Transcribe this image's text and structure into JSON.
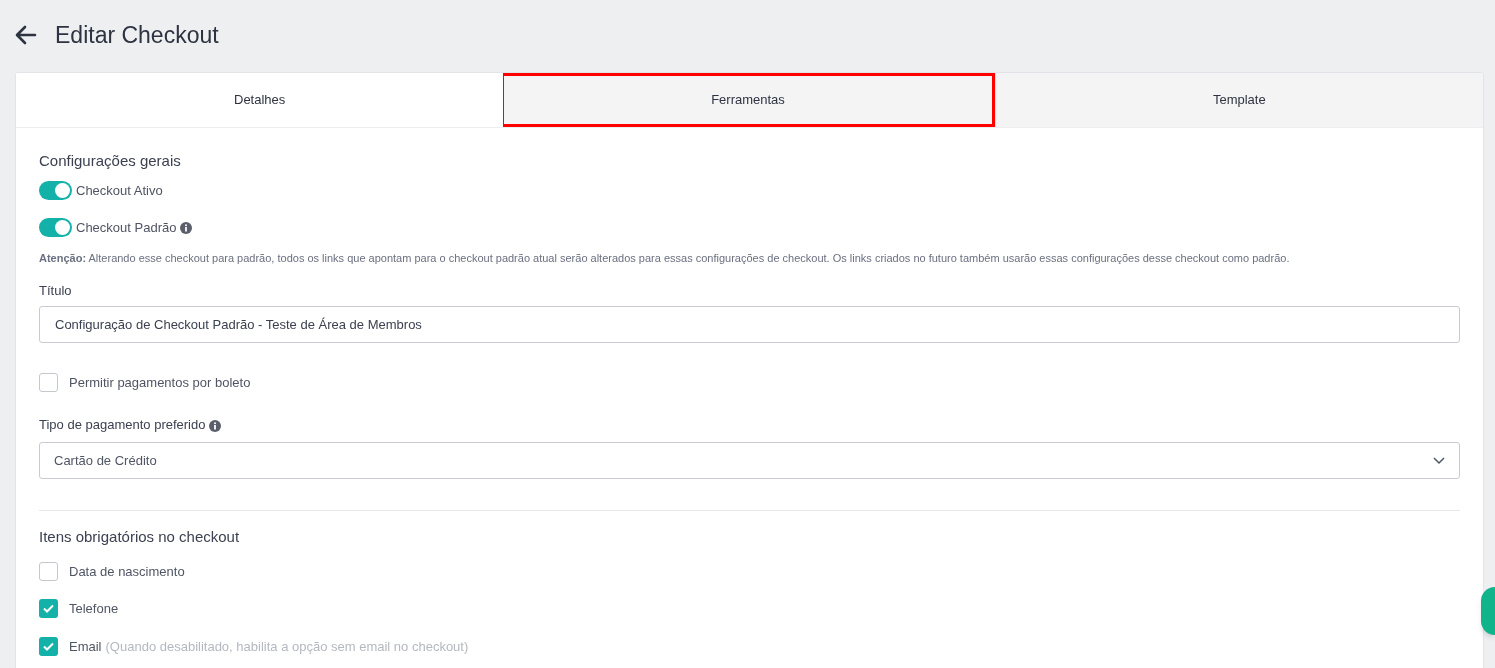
{
  "header": {
    "title": "Editar Checkout"
  },
  "tabs": [
    {
      "label": "Detalhes",
      "selected": true,
      "highlighted": false
    },
    {
      "label": "Ferramentas",
      "selected": false,
      "highlighted": true
    },
    {
      "label": "Template",
      "selected": false,
      "highlighted": false
    }
  ],
  "general": {
    "heading": "Configurações gerais",
    "toggles": [
      {
        "label": "Checkout Ativo",
        "on": true,
        "info": false
      },
      {
        "label": "Checkout Padrão",
        "on": true,
        "info": true
      }
    ],
    "notice": "**Atenção:** Alterando esse checkout para padrão, todos os links que apontam para o checkout padrão atual serão alterados para essas configurações de checkout. Os links criados no futuro também usarão essas configurações desse checkout como padrão.",
    "title_field": {
      "label": "Título",
      "value": "Configuração de Checkout Padrão - Teste de Área de Membros"
    },
    "boleto": {
      "label": "Permitir pagamentos por boleto",
      "checked": false
    },
    "payment_select": {
      "label": "Tipo de pagamento preferido",
      "value": "Cartão de Crédito"
    }
  },
  "required_items": {
    "heading": "Itens obrigatórios no checkout",
    "items": [
      {
        "label": "Data de nascimento",
        "checked": false
      },
      {
        "label": "Telefone",
        "checked": true
      },
      {
        "label": "Email",
        "hint": "(Quando desabilitado, habilita a opção sem email no checkout)",
        "checked": true
      }
    ]
  }
}
